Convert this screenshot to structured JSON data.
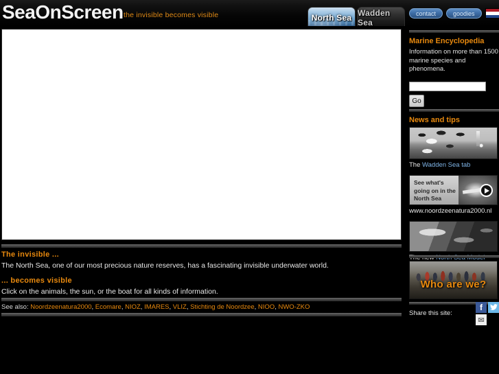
{
  "header": {
    "logo": "SeaOnScreen",
    "tagline": "the invisible becomes visible",
    "tabs": [
      {
        "label": "North Sea",
        "active": true
      },
      {
        "label": "Wadden Sea",
        "active": false
      }
    ]
  },
  "sidebar": {
    "pills": [
      {
        "label": "contact"
      },
      {
        "label": "goodies"
      }
    ],
    "flag_icon": "dutch-flag-icon",
    "encyclopedia": {
      "title": "Marine Encyclopedia",
      "body": "Information on more than 1500 marine species and phenomena.",
      "search_value": "",
      "search_placeholder": "",
      "go_label": "Go"
    },
    "news": {
      "title": "News and tips",
      "items": [
        {
          "image": "birds-lighthouse-photo",
          "caption_prefix": "The ",
          "caption_link": "Wadden Sea tab",
          "caption_suffix": ""
        },
        {
          "image": "north-sea-video-thumbnail",
          "video_text": "See what's going on in the North Sea",
          "caption_prefix": "",
          "caption_link": "www.noordzeenatura2000.nl",
          "caption_suffix": ""
        },
        {
          "image": "satellite-map-photo",
          "caption_prefix": "The new ",
          "caption_link": "North Sea Model",
          "caption_suffix": ""
        }
      ]
    },
    "who_are_we": {
      "label": "Who are we?",
      "image": "people-on-beach-photo"
    },
    "share": {
      "label": "Share this site:",
      "icons": [
        {
          "name": "facebook-icon",
          "glyph": "f"
        },
        {
          "name": "twitter-icon",
          "glyph": "ᴠ"
        },
        {
          "name": "email-icon",
          "glyph": "✉"
        }
      ]
    }
  },
  "main": {
    "stage_alt": "interactive-north-sea-scene",
    "blocks": [
      {
        "heading": "The invisible ...",
        "text": "The North Sea, one of our most precious nature reserves, has a fascinating invisible underwater world."
      },
      {
        "heading": "... becomes visible",
        "text": "Click on the animals, the sun, or the boat for all kinds of information."
      }
    ],
    "see_also": {
      "prefix": "See also: ",
      "links": [
        "Noordzeenatura2000",
        "Ecomare",
        "NIOZ",
        "IMARES",
        "VLIZ",
        "Stichting de Noordzee",
        "NIOO",
        "NWO-ZKO"
      ],
      "separator": ", "
    }
  },
  "colors": {
    "accent_orange": "#e8890e",
    "link_blue": "#7fb4e6",
    "background": "#000000",
    "stage": "#ffffff"
  }
}
